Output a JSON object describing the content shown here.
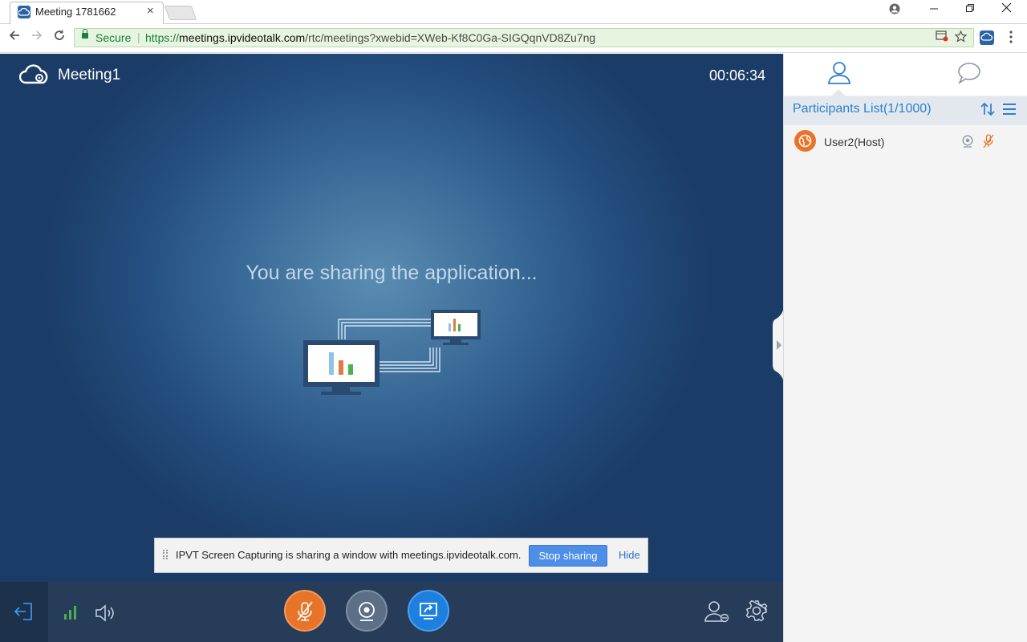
{
  "browser": {
    "tab_title": "Meeting 1781662",
    "tab_close": "×",
    "secure_label": "Secure",
    "url_scheme": "https://",
    "url_host": "meetings.ipvideotalk.com",
    "url_path": "/rtc/meetings?xwebid=XWeb-Kf8C0Ga-SIGQqnVD8Zu7ng"
  },
  "meeting": {
    "title": "Meeting1",
    "timer": "00:06:34",
    "sharing_message": "You are sharing the application..."
  },
  "notification": {
    "message": "IPVT Screen Capturing is sharing a window with meetings.ipvideotalk.com.",
    "stop_label": "Stop sharing",
    "hide_label": "Hide"
  },
  "panel": {
    "participants_title": "Participants List(1/1000)",
    "participants": [
      {
        "name": "User2(Host)"
      }
    ]
  },
  "colors": {
    "accent_blue": "#2d7fd0",
    "mic_orange": "#e8742a",
    "share_blue": "#1d7fe0",
    "secure_green": "#188038",
    "signal_green": "#4caf50"
  },
  "icons": {
    "logo": "cloud-logo-icon",
    "participants_tab": "person-icon",
    "chat_tab": "chat-bubble-icon",
    "sort": "sort-icon",
    "menu": "hamburger-icon",
    "exit": "exit-icon",
    "signal": "signal-bars-icon",
    "volume": "speaker-icon",
    "mic": "mic-muted-icon",
    "camera": "camera-icon",
    "share": "screen-share-icon",
    "invite": "invite-user-icon",
    "settings": "gear-icon"
  }
}
